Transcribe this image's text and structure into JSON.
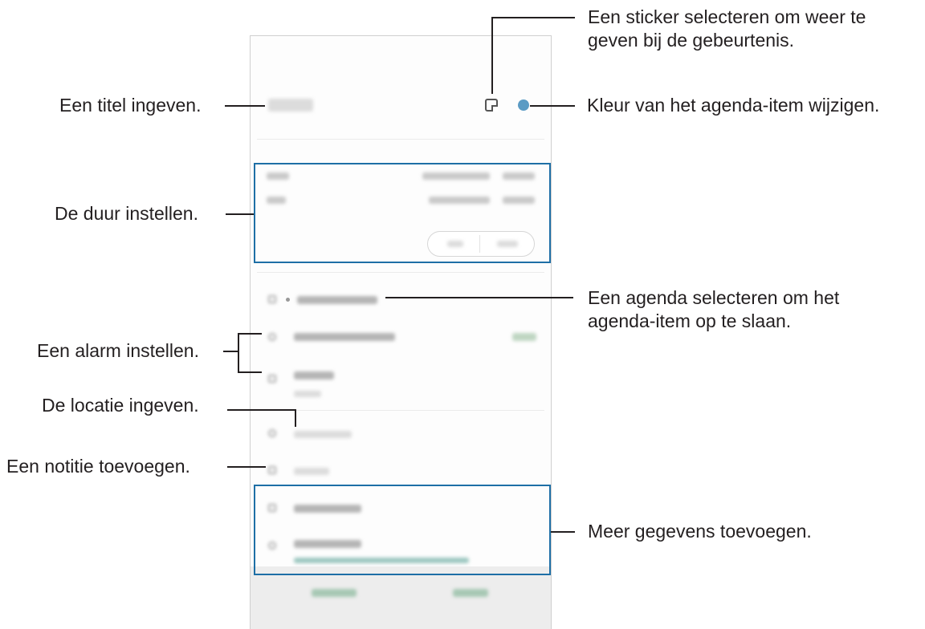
{
  "callouts": {
    "sticker": "Een sticker selecteren om weer te\ngeven bij de gebeurtenis.",
    "title": "Een titel ingeven.",
    "color": "Kleur van het agenda-item wijzigen.",
    "duration": "De duur instellen.",
    "calendar": "Een agenda selecteren om het\nagenda-item op te slaan.",
    "alarm": "Een alarm instellen.",
    "location": "De locatie ingeven.",
    "note": "Een notitie toevoegen.",
    "more": "Meer gegevens toevoegen."
  },
  "colors": {
    "frame": "#1e6fa6",
    "event_color": "#5b9bc4"
  },
  "icons": [
    "sticker-icon",
    "color-dot-icon",
    "calendar-icon",
    "alarm-icon",
    "repeat-icon",
    "location-icon",
    "note-icon",
    "attach-icon",
    "timezone-icon"
  ]
}
